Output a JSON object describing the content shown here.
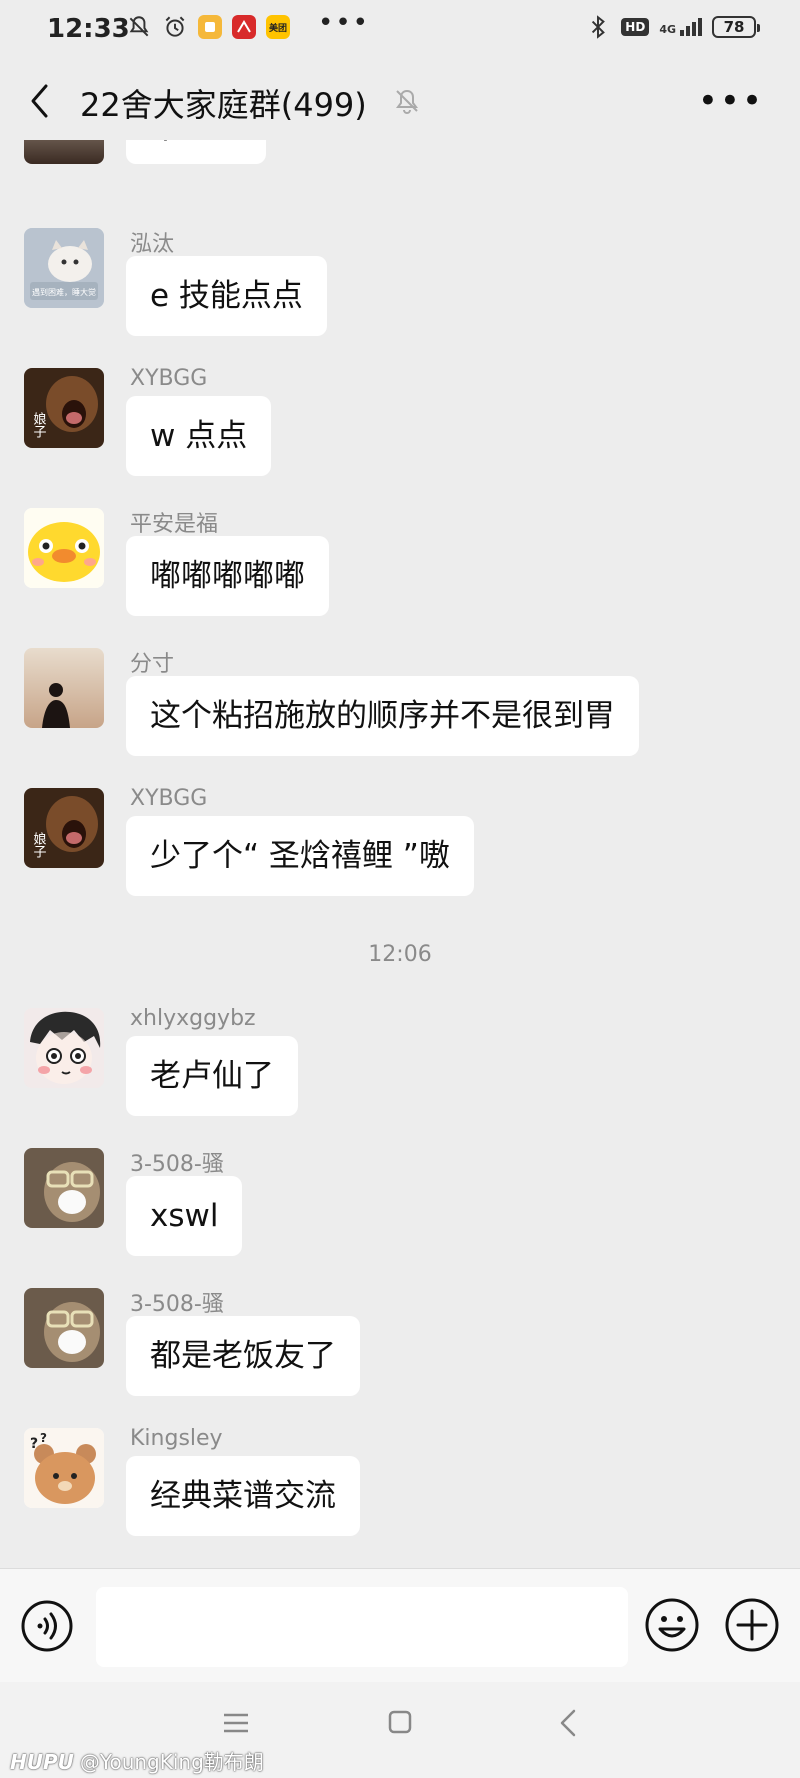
{
  "status_bar": {
    "time": "12:33",
    "app_badge_label": "美团",
    "hd_label": "HD",
    "network_label": "4G",
    "battery": "78"
  },
  "header": {
    "title": "22舍大家庭群(499)"
  },
  "messages": [
    {
      "sender": "",
      "text": "q 点点"
    },
    {
      "sender": "泓汰",
      "text": "e 技能点点"
    },
    {
      "sender": "XYBGG",
      "text": "w 点点"
    },
    {
      "sender": "平安是福",
      "text": "嘟嘟嘟嘟嘟"
    },
    {
      "sender": "分寸",
      "text": "这个粘招施放的顺序并不是很到胃"
    },
    {
      "sender": "XYBGG",
      "text": "少了个“ 圣焓禧鲤 ”嗷"
    },
    {
      "sender": "xhlyxggybz",
      "text": "老卢仙了"
    },
    {
      "sender": "3-508-骚",
      "text": "xswl"
    },
    {
      "sender": "3-508-骚",
      "text": "都是老饭友了"
    },
    {
      "sender": "Kingsley",
      "text": "经典菜谱交流"
    }
  ],
  "timestamp": "12:06",
  "avatar_texts": {
    "cat": "遇到困难，睡大觉",
    "dog": "娘子"
  },
  "input": {
    "placeholder": ""
  },
  "watermark": {
    "brand": "HUPU",
    "handle": "@YoungKing勒布朗"
  },
  "colors": {
    "background": "#ededed",
    "bubble": "#ffffff",
    "sender": "#8a8a8a"
  }
}
